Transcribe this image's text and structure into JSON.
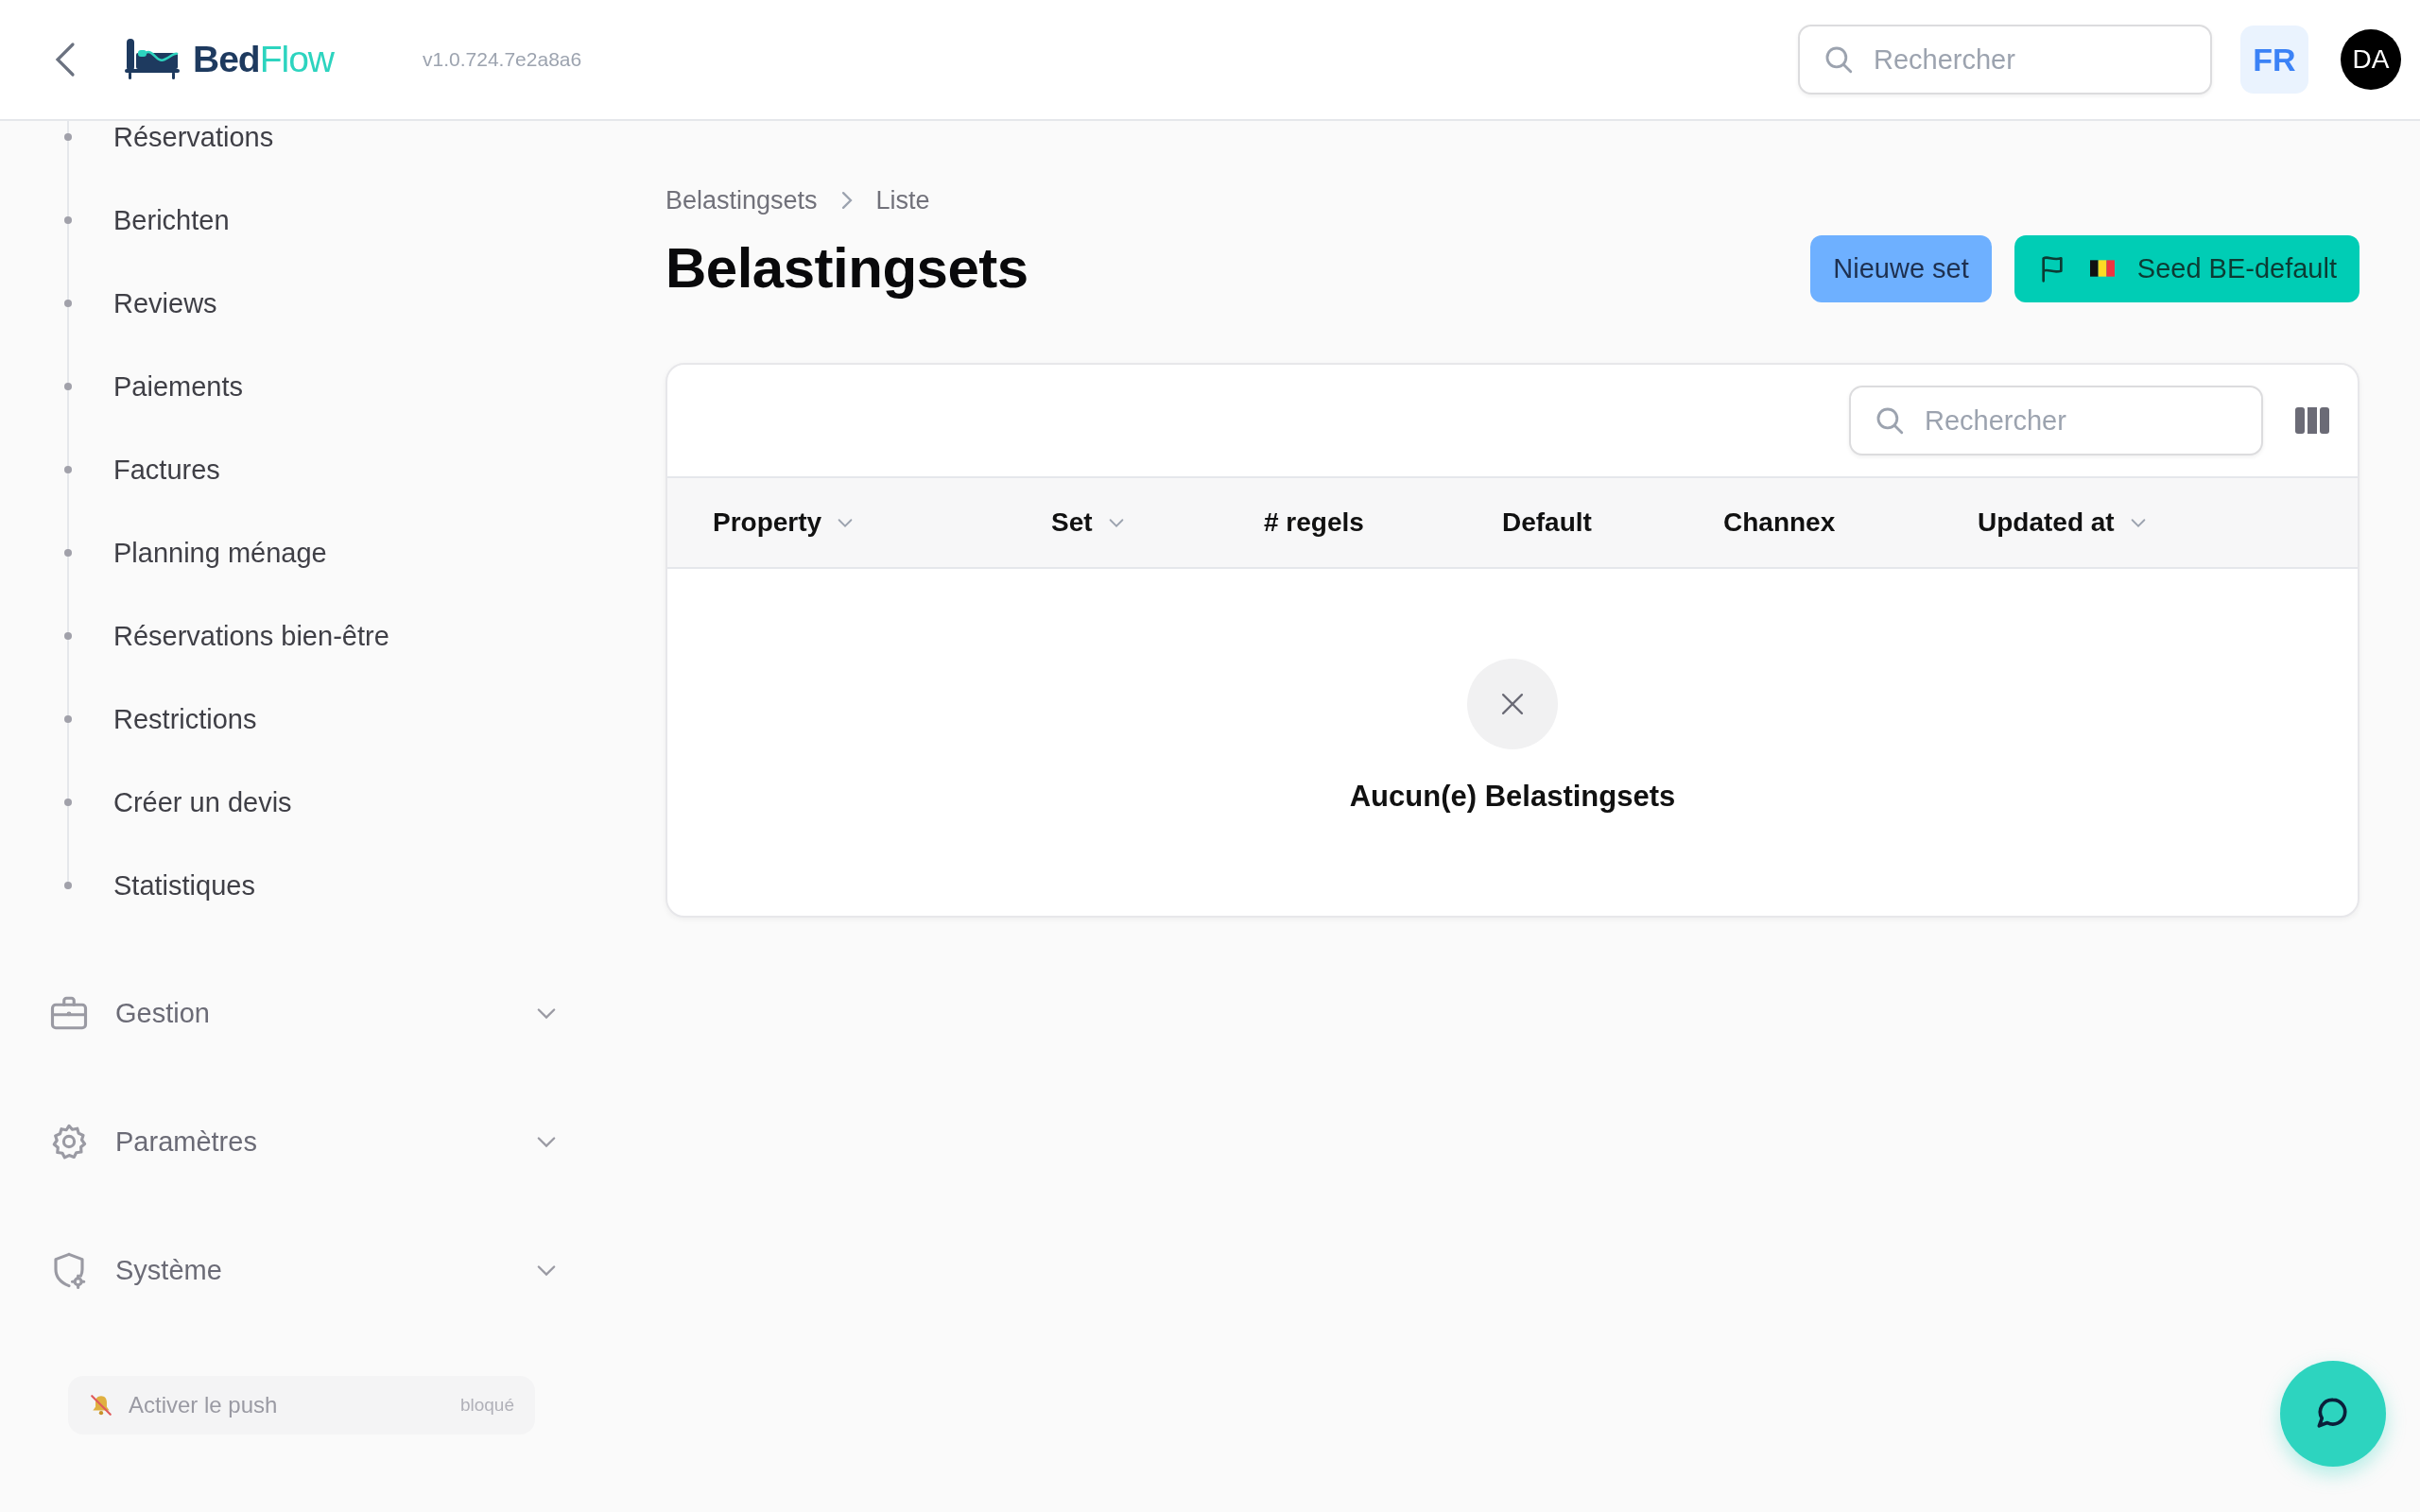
{
  "header": {
    "logo": {
      "part1": "Bed",
      "part2": "Flow"
    },
    "version": "v1.0.724.7e2a8a6",
    "search": {
      "placeholder": "Rechercher"
    },
    "language": "FR",
    "avatar": "DA"
  },
  "sidebar": {
    "items": [
      {
        "label": "Réservations"
      },
      {
        "label": "Berichten"
      },
      {
        "label": "Reviews"
      },
      {
        "label": "Paiements"
      },
      {
        "label": "Factures"
      },
      {
        "label": "Planning ménage"
      },
      {
        "label": "Réservations bien-être"
      },
      {
        "label": "Restrictions"
      },
      {
        "label": "Créer un devis"
      },
      {
        "label": "Statistiques"
      }
    ],
    "sections": [
      {
        "label": "Gestion",
        "kind": "briefcase",
        "expanded": false
      },
      {
        "label": "Paramètres",
        "kind": "gear",
        "expanded": false
      },
      {
        "label": "Système",
        "kind": "shield",
        "expanded": false
      }
    ],
    "push": {
      "label": "Activer le push",
      "status": "bloqué"
    }
  },
  "breadcrumb": [
    "Belastingsets",
    "Liste"
  ],
  "title": "Belastingsets",
  "actions": [
    {
      "label": "Nieuwe set",
      "kind": "primary"
    },
    {
      "label": "Seed BE-default",
      "kind": "seed"
    }
  ],
  "table": {
    "search": {
      "placeholder": "Rechercher"
    },
    "columns": [
      {
        "label": "Property",
        "sortable": true
      },
      {
        "label": "Set",
        "sortable": true
      },
      {
        "label": "# regels",
        "sortable": false
      },
      {
        "label": "Default",
        "sortable": false
      },
      {
        "label": "Channex",
        "sortable": false
      },
      {
        "label": "Updated at",
        "sortable": true
      }
    ],
    "empty": "Aucun(e) Belastingsets"
  }
}
